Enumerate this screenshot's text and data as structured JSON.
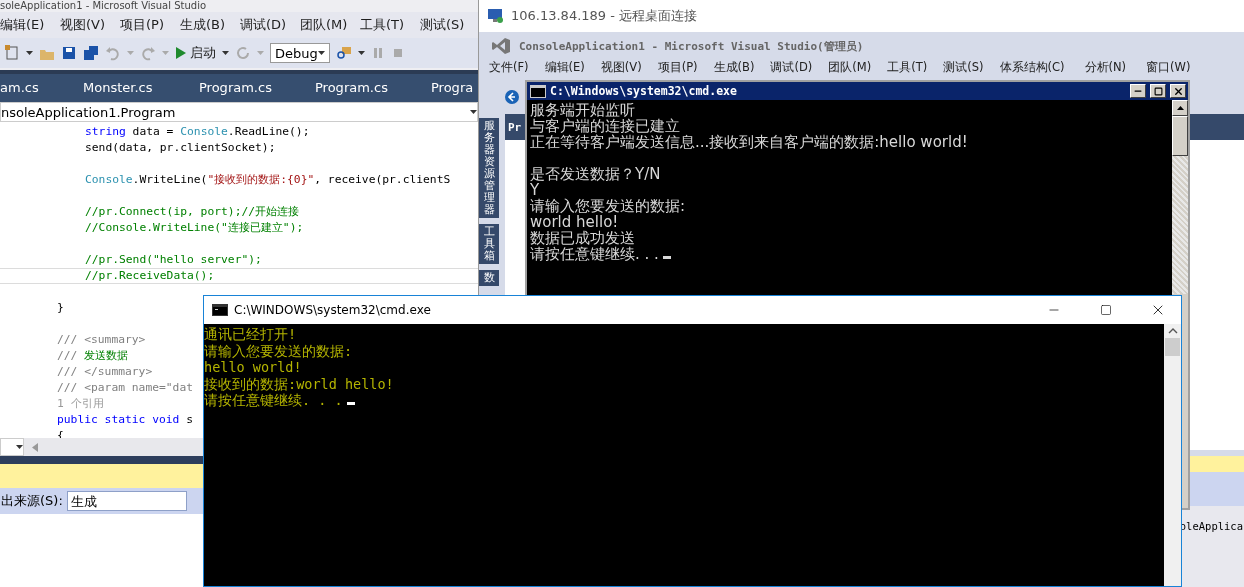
{
  "vs": {
    "title": "soleApplication1 - Microsoft Visual Studio",
    "menu": [
      "编辑(E)",
      "视图(V)",
      "项目(P)",
      "生成(B)",
      "调试(D)",
      "团队(M)",
      "工具(T)",
      "测试(S)"
    ],
    "toolbar": {
      "start": "启动",
      "config": "Debug"
    },
    "tabs": [
      {
        "label": "am.cs",
        "selected": false
      },
      {
        "label": "Monster.cs",
        "selected": false
      },
      {
        "label": "Program.cs",
        "selected": false
      },
      {
        "label": "Program.cs",
        "selected": false
      },
      {
        "label": "Progra",
        "selected": false
      }
    ],
    "nav": "nsoleApplication1.Program",
    "code": [
      {
        "nested": true,
        "current": false,
        "tokens": [
          {
            "kind": "keyword",
            "text": "string"
          },
          {
            "kind": "plain",
            "text": " data = "
          },
          {
            "kind": "type",
            "text": "Console"
          },
          {
            "kind": "plain",
            "text": ".ReadLine();"
          }
        ]
      },
      {
        "nested": true,
        "current": false,
        "tokens": [
          {
            "kind": "plain",
            "text": "send(data, pr.clientSocket);"
          }
        ]
      },
      {
        "current": false
      },
      {
        "nested": true,
        "current": false,
        "tokens": [
          {
            "kind": "type",
            "text": "Console"
          },
          {
            "kind": "plain",
            "text": ".WriteLine("
          },
          {
            "kind": "string",
            "text": "\"接收到的数据:{0}\""
          },
          {
            "kind": "plain",
            "text": ", receive(pr.clientS"
          }
        ]
      },
      {
        "current": false
      },
      {
        "nested": true,
        "current": false,
        "tokens": [
          {
            "kind": "comment",
            "text": "//pr.Connect(ip, port);//开始连接"
          }
        ]
      },
      {
        "nested": true,
        "current": false,
        "tokens": [
          {
            "kind": "comment",
            "text": "//Console.WriteLine(\"连接已建立\");"
          }
        ]
      },
      {
        "current": false
      },
      {
        "nested": true,
        "current": false,
        "tokens": [
          {
            "kind": "comment",
            "text": "//pr.Send(\"hello server\");"
          }
        ]
      },
      {
        "nested": true,
        "current": true,
        "tokens": [
          {
            "kind": "comment",
            "text": "//pr.ReceiveData();"
          }
        ]
      },
      {
        "current": false
      },
      {
        "nested": false,
        "current": false,
        "tokens": [
          {
            "kind": "plain",
            "text": "}"
          }
        ]
      },
      {
        "current": false
      },
      {
        "nested": false,
        "current": false,
        "tokens": [
          {
            "kind": "doc",
            "text": "/// <summary>"
          }
        ]
      },
      {
        "nested": false,
        "current": false,
        "tokens": [
          {
            "kind": "doc",
            "text": "/// "
          },
          {
            "kind": "comment",
            "text": "发送数据"
          }
        ]
      },
      {
        "nested": false,
        "current": false,
        "tokens": [
          {
            "kind": "doc",
            "text": "/// </summary>"
          }
        ]
      },
      {
        "nested": false,
        "current": false,
        "tokens": [
          {
            "kind": "doc",
            "text": "/// <param name=\"dat"
          }
        ]
      },
      {
        "nested": false,
        "current": false,
        "tokens": [
          {
            "kind": "lens",
            "text": "1 个引用"
          }
        ]
      },
      {
        "nested": false,
        "current": false,
        "tokens": [
          {
            "kind": "keyword",
            "text": "public static void"
          },
          {
            "kind": "plain",
            "text": " s"
          }
        ]
      },
      {
        "nested": false,
        "current": false,
        "tokens": [
          {
            "kind": "plain",
            "text": "{"
          }
        ]
      }
    ],
    "output": {
      "label": "出来源(S):",
      "source": "生成"
    }
  },
  "remote": {
    "title": "106.13.84.189 - 远程桌面连接",
    "app_title": "ConsoleApplication1 - Microsoft Visual Studio(管理员)",
    "menu": [
      "文件(F)",
      "编辑(E)",
      "视图(V)",
      "项目(P)",
      "生成(B)",
      "调试(D)",
      "团队(M)",
      "工具(T)",
      "测试(S)",
      "体系结构(C)",
      "分析(N)",
      "窗口(W)"
    ],
    "side_tabs": [
      "服务器资源管理器",
      "工具箱",
      "数"
    ],
    "doc_tab": "Pr",
    "status_text": "oleApplica",
    "console": {
      "title": "C:\\Windows\\system32\\cmd.exe",
      "lines": [
        {
          "kind": "text",
          "text": "服务端开始监听"
        },
        {
          "kind": "text",
          "text": "与客户端的连接已建立"
        },
        {
          "kind": "text",
          "text": "正在等待客户端发送信息...接收到来自客户端的数据:hello world!"
        },
        {
          "kind": "blank"
        },
        {
          "kind": "text",
          "text": "是否发送数据？Y/N"
        },
        {
          "kind": "text",
          "text": "Y"
        },
        {
          "kind": "text",
          "text": "请输入您要发送的数据:"
        },
        {
          "kind": "text",
          "text": "world hello!"
        },
        {
          "kind": "text",
          "text": "数据已成功发送"
        },
        {
          "kind": "text",
          "text": "请按任意键继续. . ."
        }
      ]
    }
  },
  "console": {
    "title": "C:\\WINDOWS\\system32\\cmd.exe",
    "lines": [
      "通讯已经打开!",
      "请输入您要发送的数据:",
      "hello world!",
      "接收到的数据:world hello!",
      "请按任意键继续. . ."
    ]
  }
}
